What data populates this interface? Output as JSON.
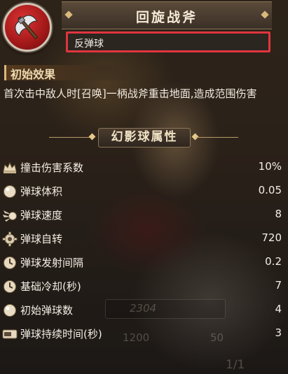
{
  "header": {
    "title": "回旋战斧",
    "weapon_icon": "battle-axe-icon"
  },
  "name_field": {
    "value": "反弹球"
  },
  "initial_effect": {
    "heading": "初始效果",
    "text": "首次击中敌人时[召唤]一柄战斧重击地面,造成范围伤害"
  },
  "attributes": {
    "heading": "幻影球属性",
    "items": [
      {
        "label": "撞击伤害系数",
        "value": "10%",
        "icon": "damage-crown-icon"
      },
      {
        "label": "弹球体积",
        "value": "0.05",
        "icon": "ball-icon"
      },
      {
        "label": "弹球速度",
        "value": "8",
        "icon": "speed-comet-icon"
      },
      {
        "label": "弹球自转",
        "value": "720",
        "icon": "spin-gear-icon"
      },
      {
        "label": "弹球发射间隔",
        "value": "0.2",
        "icon": "clock-icon"
      },
      {
        "label": "基础冷却(秒)",
        "value": "7",
        "icon": "clock-icon"
      },
      {
        "label": "初始弹球数",
        "value": "4",
        "icon": "ball-icon"
      },
      {
        "label": "弹球持续时间(秒)",
        "value": "3",
        "icon": "duration-bar-icon"
      }
    ]
  },
  "background": {
    "power": "2304",
    "stat_a": "1200",
    "stat_b": "50",
    "page": "1/1"
  },
  "colors": {
    "highlight_border": "#e0353f",
    "accent_gold": "#d9b97a"
  }
}
